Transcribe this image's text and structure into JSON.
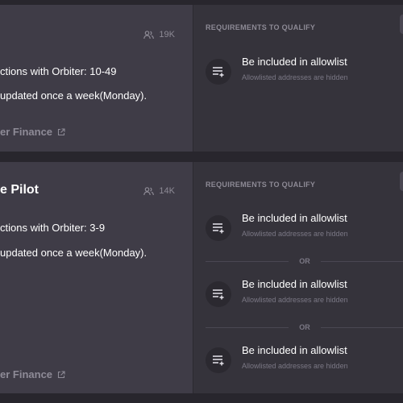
{
  "cards": [
    {
      "members": "19K",
      "task_line": "ctions with Orbiter: 10-49",
      "update_line": "updated once a week(Monday).",
      "link_label": "er Finance",
      "requirements_header": "REQUIREMENTS TO QUALIFY",
      "requirements": [
        {
          "title": "Be included in allowlist",
          "subtitle": "Allowlisted addresses are hidden"
        }
      ]
    },
    {
      "title": "e Pilot",
      "members": "14K",
      "task_line": "ctions with Orbiter: 3-9",
      "update_line": "updated once a week(Monday).",
      "link_label": "er Finance",
      "requirements_header": "REQUIREMENTS TO QUALIFY",
      "requirements": [
        {
          "title": "Be included in allowlist",
          "subtitle": "Allowlisted addresses are hidden"
        },
        {
          "title": "Be included in allowlist",
          "subtitle": "Allowlisted addresses are hidden"
        },
        {
          "title": "Be included in allowlist",
          "subtitle": "Allowlisted addresses are hidden"
        }
      ],
      "separator": "OR"
    }
  ],
  "icons": {
    "members": "people-icon",
    "external": "external-link-icon",
    "requirement": "list-add-icon"
  },
  "colors": {
    "background": "#28262d",
    "card_left": "#3f3c47",
    "card_right": "#35333b",
    "muted_text": "#8d8a95"
  }
}
